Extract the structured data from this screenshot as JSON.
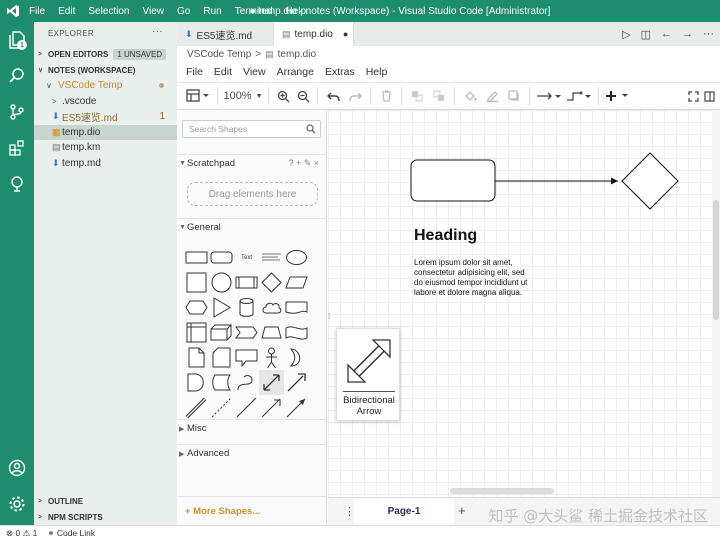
{
  "titlebar": {
    "menu": [
      "File",
      "Edit",
      "Selection",
      "View",
      "Go",
      "Run",
      "Terminal",
      "Help"
    ],
    "title": "● temp.dio - notes (Workspace) - Visual Studio Code [Administrator]"
  },
  "activity": {
    "explorer_badge": "1"
  },
  "sidebar": {
    "header": "EXPLORER",
    "open_editors": "OPEN EDITORS",
    "unsaved": "1 UNSAVED",
    "workspace": "NOTES (WORKSPACE)",
    "folder": "VSCode Temp",
    "items": [
      {
        "label": ".vscode",
        "kind": "folder"
      },
      {
        "label": "ES5速览.md",
        "kind": "md",
        "badge": "1"
      },
      {
        "label": "temp.dio",
        "kind": "dio"
      },
      {
        "label": "temp.km",
        "kind": "km"
      },
      {
        "label": "temp.md",
        "kind": "md"
      }
    ],
    "outline": "OUTLINE",
    "npm": "NPM SCRIPTS"
  },
  "tabs": [
    {
      "label": "ES5速览.md",
      "active": false
    },
    {
      "label": "temp.dio",
      "active": true,
      "dirty": "●"
    }
  ],
  "breadcrumb": {
    "folder": "VSCode Temp",
    "sep": ">",
    "file": "temp.dio"
  },
  "drawio": {
    "menu": [
      "File",
      "Edit",
      "View",
      "Arrange",
      "Extras",
      "Help"
    ],
    "zoom": "100%",
    "search_placeholder": "Search Shapes",
    "scratchpad": "Scratchpad",
    "scratch_actions": "? + ✎ ×",
    "drag_here": "Drag elements here",
    "general": "General",
    "misc": "Misc",
    "advanced": "Advanced",
    "more_shapes": "+ More Shapes...",
    "text_shape": "Text",
    "page": "Page-1",
    "canvas": {
      "heading": "Heading",
      "lorem": [
        "Lorem ipsum dolor sit amet,",
        "consectetur adipisicing elit, sed",
        "do eiusmod tempor incididunt ut",
        "labore et dolore magna aliqua."
      ]
    },
    "tooltip": [
      "Bidirectional",
      "Arrow"
    ]
  },
  "status": {
    "errors": "0",
    "warnings": "1",
    "link": "Code Link"
  },
  "watermark": "知乎 @大头鲨 稀土掘金技术社区",
  "colors": {
    "accent": "#1e8d6e"
  }
}
